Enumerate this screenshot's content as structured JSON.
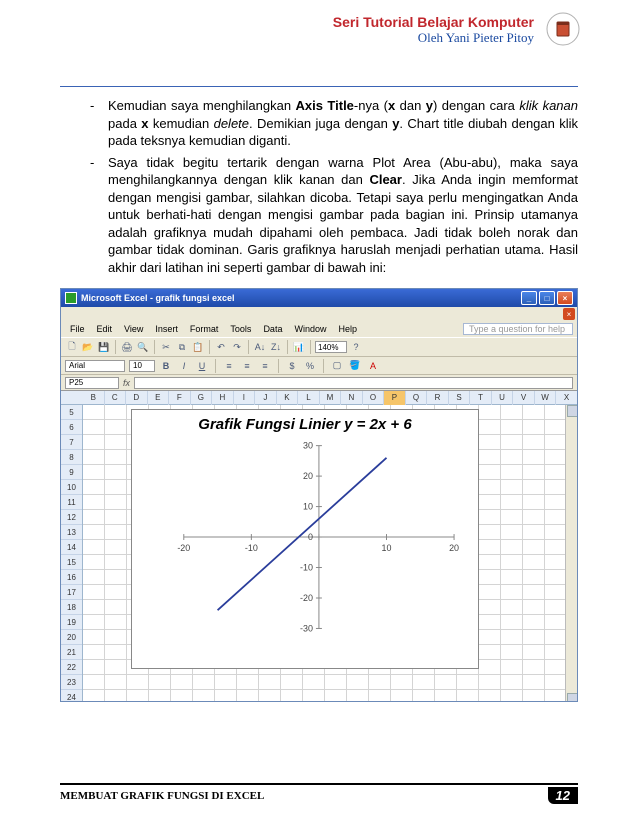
{
  "header": {
    "series_title": "Seri Tutorial Belajar Komputer",
    "author": "Oleh Yani Pieter Pitoy"
  },
  "body": {
    "b1_pre": "Kemudian saya menghilangkan ",
    "b1_bold1": "Axis Title",
    "b1_mid1": "-nya (",
    "b1_bold2": "x",
    "b1_mid2": " dan ",
    "b1_bold3": "y",
    "b1_mid3": ") dengan cara ",
    "b1_i1": "klik kanan",
    "b1_mid4": " pada ",
    "b1_bold4": "x",
    "b1_mid5": " kemudian ",
    "b1_i2": "delete",
    "b1_mid6": ". Demikian juga dengan ",
    "b1_bold5": "y",
    "b1_end": ". Chart title diubah dengan klik pada teksnya kemudian diganti.",
    "b2_pre": "Saya tidak begitu tertarik dengan warna Plot Area (Abu-abu), maka saya menghilangkannya dengan klik kanan dan  ",
    "b2_bold1": "Clear",
    "b2_end": ". Jika Anda ingin memformat dengan mengisi gambar, silahkan dicoba. Tetapi saya perlu mengingatkan Anda untuk berhati-hati dengan mengisi gambar pada bagian ini. Prinsip utamanya adalah grafiknya mudah dipahami oleh pembaca. Jadi tidak boleh norak dan gambar tidak dominan. Garis grafiknya haruslah menjadi perhatian utama. Hasil akhir dari latihan ini seperti gambar di bawah ini:"
  },
  "excel": {
    "title": "Microsoft Excel - grafik fungsi excel",
    "menus": [
      "File",
      "Edit",
      "View",
      "Insert",
      "Format",
      "Tools",
      "Data",
      "Window",
      "Help"
    ],
    "help_placeholder": "Type a question for help",
    "zoom": "140%",
    "font": "Arial",
    "font_size": "10",
    "namebox": "P25",
    "columns": [
      "B",
      "C",
      "D",
      "E",
      "F",
      "G",
      "H",
      "I",
      "J",
      "K",
      "L",
      "M",
      "N",
      "O",
      "P",
      "Q",
      "R",
      "S",
      "T",
      "U",
      "V",
      "W",
      "X"
    ],
    "selected_col": "P",
    "rows": [
      "5",
      "6",
      "7",
      "8",
      "9",
      "10",
      "11",
      "12",
      "13",
      "14",
      "15",
      "16",
      "17",
      "18",
      "19",
      "20",
      "21",
      "22",
      "23",
      "24"
    ]
  },
  "chart_data": {
    "type": "line",
    "title": "Grafik Fungsi Linier y = 2x + 6",
    "xlabel": "",
    "ylabel": "",
    "x_ticks": [
      -20,
      -10,
      0,
      10,
      20
    ],
    "y_ticks": [
      -30,
      -20,
      -10,
      0,
      10,
      20,
      30
    ],
    "xlim": [
      -20,
      20
    ],
    "ylim": [
      -30,
      30
    ],
    "series": [
      {
        "name": "y = 2x + 6",
        "color": "#2a3d9b",
        "x": [
          -15,
          10
        ],
        "y": [
          -24,
          26
        ]
      }
    ]
  },
  "footer": {
    "left": "MEMBUAT GRAFIK FUNGSI DI EXCEL",
    "page": "12"
  }
}
